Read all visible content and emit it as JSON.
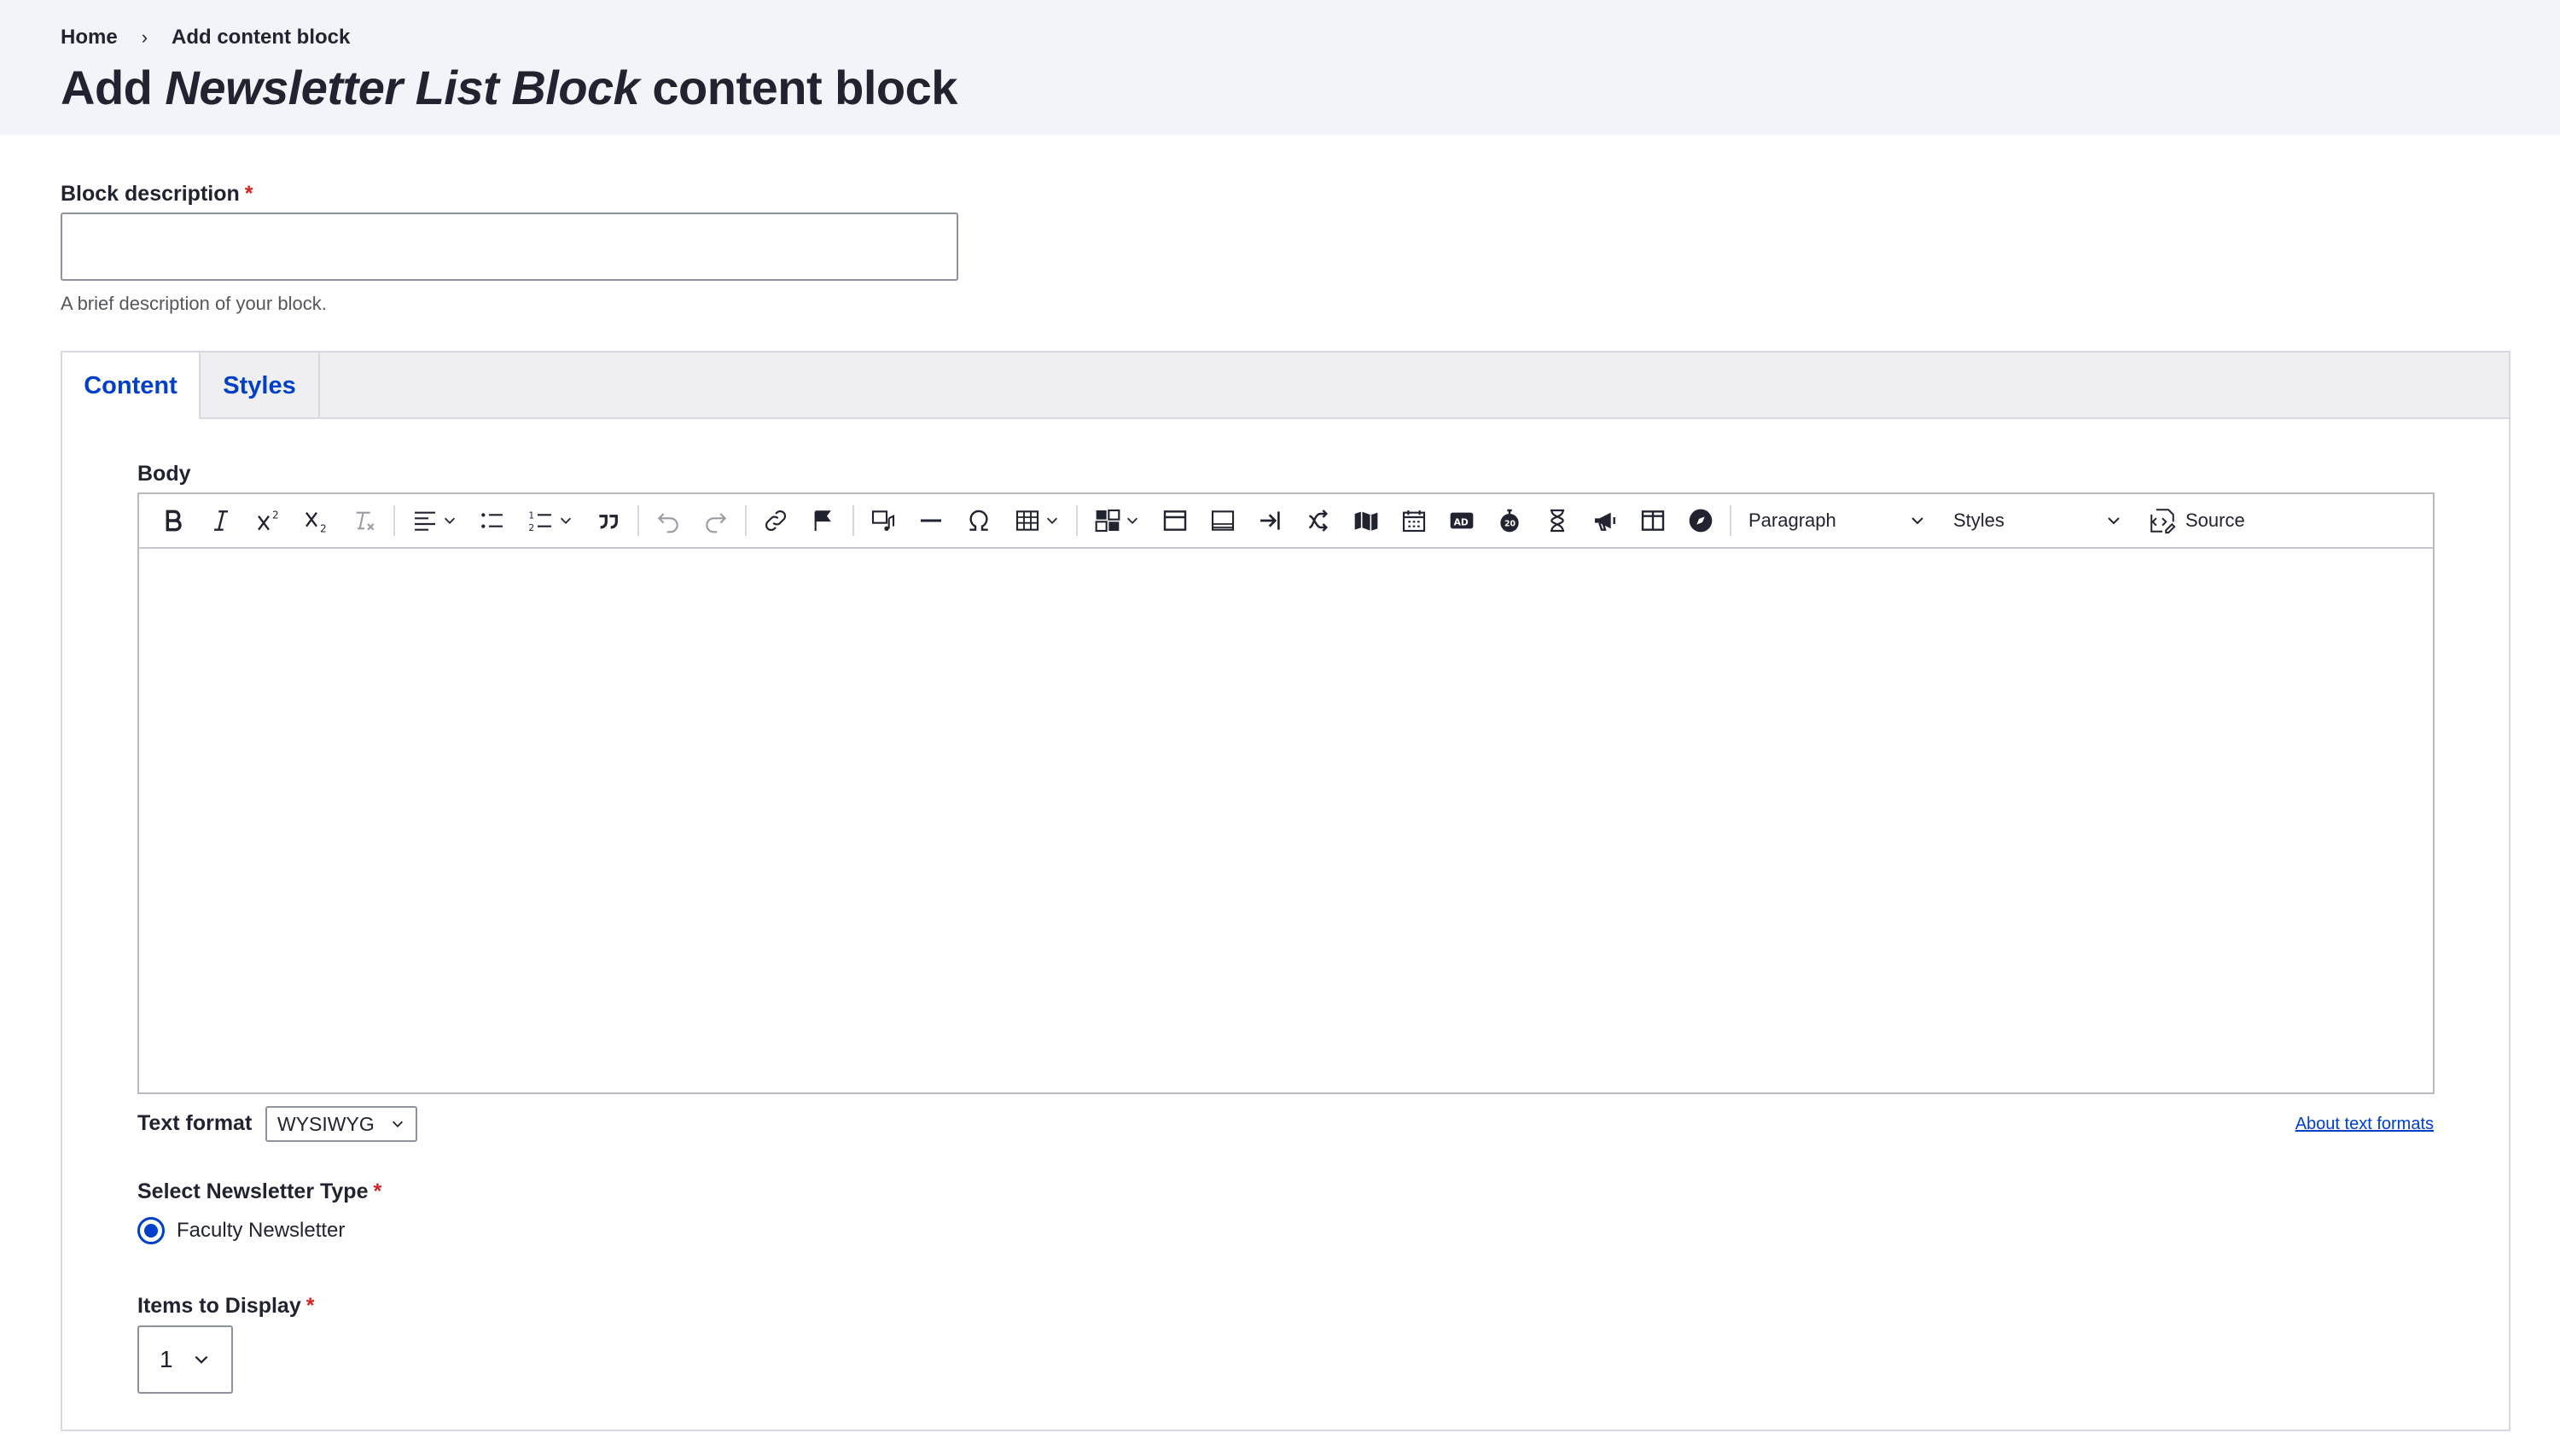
{
  "breadcrumb": {
    "home": "Home",
    "separator": "›",
    "current": "Add content block"
  },
  "title": {
    "prefix": "Add ",
    "type_name": "Newsletter List Block",
    "suffix": " content block"
  },
  "block_description": {
    "label": "Block description",
    "required_mark": "*",
    "value": "",
    "help": "A brief description of your block."
  },
  "tabs": [
    {
      "label": "Content",
      "active": true
    },
    {
      "label": "Styles",
      "active": false
    }
  ],
  "body": {
    "label": "Body",
    "toolbar": {
      "paragraph_dropdown": "Paragraph",
      "styles_dropdown": "Styles",
      "source_label": "Source",
      "icons": [
        "bold-icon",
        "italic-icon",
        "superscript-icon",
        "subscript-icon",
        "remove-format-icon",
        "align-icon",
        "bulleted-list-icon",
        "numbered-list-icon",
        "blockquote-icon",
        "undo-icon",
        "redo-icon",
        "link-icon",
        "anchor-flag-icon",
        "media-icon",
        "horizontal-line-icon",
        "special-characters-icon",
        "table-icon",
        "insert-media-icon",
        "card-icon",
        "footer-icon",
        "sign-in-icon",
        "route-icon",
        "map-icon",
        "calendar-icon",
        "ad-icon",
        "timer-icon",
        "hourglass-icon",
        "megaphone-icon",
        "columns-icon",
        "compass-icon",
        "source-icon"
      ]
    },
    "content": ""
  },
  "text_format": {
    "label": "Text format",
    "selected": "WYSIWYG",
    "about_link": "About text formats"
  },
  "newsletter_type": {
    "label": "Select Newsletter Type",
    "required_mark": "*",
    "options": [
      {
        "label": "Faculty Newsletter",
        "checked": true
      }
    ]
  },
  "items_to_display": {
    "label": "Items to Display",
    "required_mark": "*",
    "selected": "1"
  },
  "colors": {
    "accent": "#003ecc",
    "required": "#d72222",
    "header_bg": "#f3f4f9",
    "text": "#222330"
  }
}
